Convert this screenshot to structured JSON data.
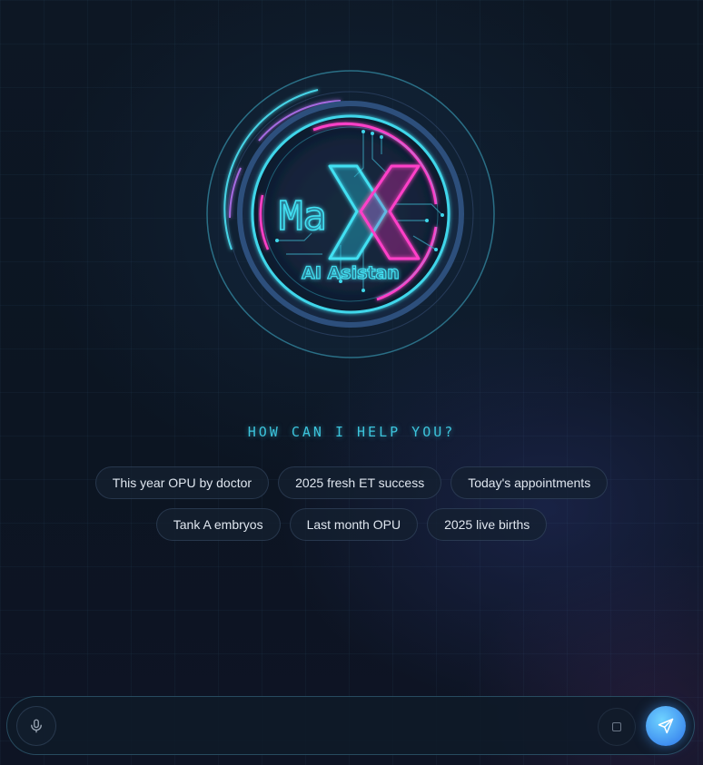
{
  "logo": {
    "wordmark_left": "Ma",
    "wordmark_right": "X",
    "subtitle": "AI Asistan"
  },
  "tagline": "HOW CAN I HELP YOU?",
  "suggestions": {
    "row1": [
      "This year OPU by doctor",
      "2025 fresh ET success",
      "Today's appointments"
    ],
    "row2": [
      "Tank A embryos",
      "Last month OPU",
      "2025 live births"
    ]
  },
  "composer": {
    "input_value": "",
    "input_placeholder": "",
    "mic_icon": "microphone-icon",
    "stop_icon": "stop-icon",
    "send_icon": "send-icon"
  },
  "colors": {
    "accent_cyan": "#3cc4dc",
    "accent_magenta": "#ff3fc8",
    "send_blue": "#3d8cf0",
    "background": "#0d1724"
  }
}
